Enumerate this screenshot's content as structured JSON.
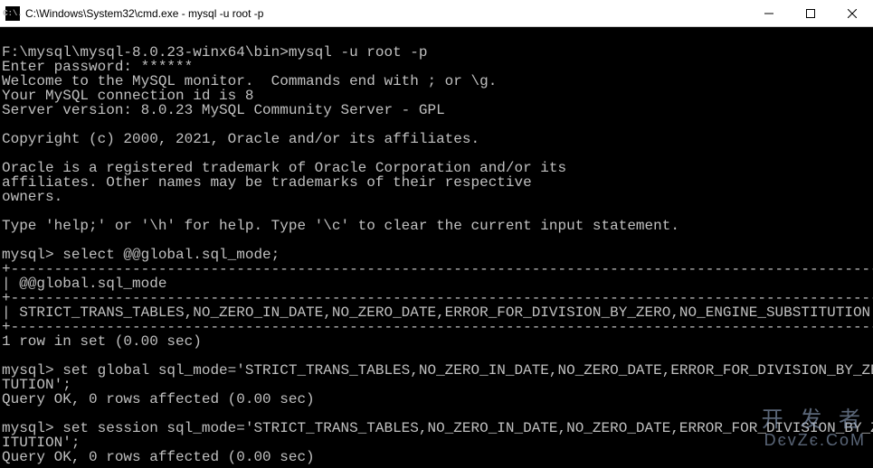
{
  "titlebar": {
    "icon_text": "C:\\.",
    "title": "C:\\Windows\\System32\\cmd.exe - mysql  -u root -p"
  },
  "terminal": {
    "lines": [
      "",
      "F:\\mysql\\mysql-8.0.23-winx64\\bin>mysql -u root -p",
      "Enter password: ******",
      "Welcome to the MySQL monitor.  Commands end with ; or \\g.",
      "Your MySQL connection id is 8",
      "Server version: 8.0.23 MySQL Community Server - GPL",
      "",
      "Copyright (c) 2000, 2021, Oracle and/or its affiliates.",
      "",
      "Oracle is a registered trademark of Oracle Corporation and/or its",
      "affiliates. Other names may be trademarks of their respective",
      "owners.",
      "",
      "Type 'help;' or '\\h' for help. Type '\\c' to clear the current input statement.",
      "",
      "mysql> select @@global.sql_mode;",
      "+-----------------------------------------------------------------------------------------------------+",
      "| @@global.sql_mode                                                                                   |",
      "+-----------------------------------------------------------------------------------------------------+",
      "| STRICT_TRANS_TABLES,NO_ZERO_IN_DATE,NO_ZERO_DATE,ERROR_FOR_DIVISION_BY_ZERO,NO_ENGINE_SUBSTITUTION |",
      "+-----------------------------------------------------------------------------------------------------+",
      "1 row in set (0.00 sec)",
      "",
      "mysql> set global sql_mode='STRICT_TRANS_TABLES,NO_ZERO_IN_DATE,NO_ZERO_DATE,ERROR_FOR_DIVISION_BY_ZERO,NO_ENGINE_SUBSTI",
      "TUTION';",
      "Query OK, 0 rows affected (0.00 sec)",
      "",
      "mysql> set session sql_mode='STRICT_TRANS_TABLES,NO_ZERO_IN_DATE,NO_ZERO_DATE,ERROR_FOR_DIVISION_BY_ZERO,NO_ENGINE_SUBST",
      "ITUTION';",
      "Query OK, 0 rows affected (0.00 sec)"
    ]
  },
  "watermark": {
    "top": "开 发 者",
    "bottom": "DєvZє.CoM"
  }
}
